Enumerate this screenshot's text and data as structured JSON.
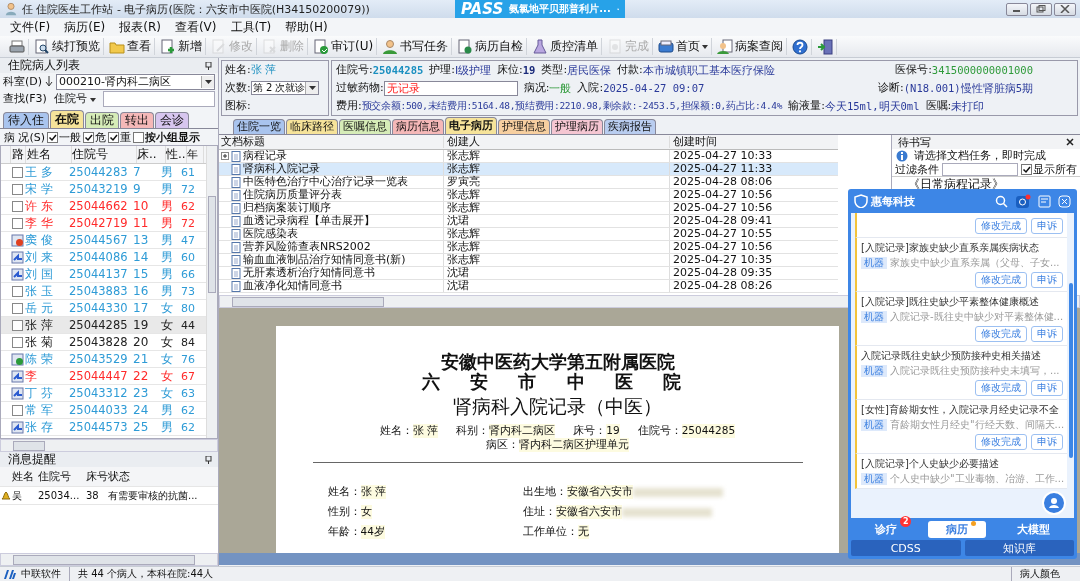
{
  "window": {
    "title": "任 住院医生工作站 - 电子病历(医院：六安市中医院(H34150200079))"
  },
  "pass_bar": {
    "logo": "PASS",
    "drug": "氨氯地平贝那普利片..."
  },
  "menu": [
    "文件(F)",
    "病历(E)",
    "报表(R)",
    "查看(V)",
    "工具(T)",
    "帮助(H)"
  ],
  "toolbar": [
    {
      "kind": "print",
      "disabled": false
    },
    {
      "kind": "preview",
      "label": "续打预览",
      "disabled": false
    },
    {
      "kind": "folder",
      "label": "查看",
      "disabled": false
    },
    {
      "kind": "new",
      "label": "新增",
      "disabled": false
    },
    {
      "kind": "edit",
      "label": "修改",
      "disabled": true
    },
    {
      "kind": "delete",
      "label": "删除",
      "disabled": true
    },
    {
      "kind": "audit",
      "label": "审订(U)",
      "disabled": false
    },
    {
      "kind": "task",
      "label": "书写任务",
      "disabled": false
    },
    {
      "kind": "selfcheck",
      "label": "病历自检",
      "disabled": false
    },
    {
      "kind": "quality",
      "label": "质控清单",
      "disabled": false
    },
    {
      "kind": "done",
      "label": "完成",
      "disabled": true
    },
    {
      "kind": "home",
      "label": "首页",
      "disabled": false
    },
    {
      "kind": "review",
      "label": "病案查阅",
      "disabled": false
    },
    {
      "kind": "help",
      "disabled": false
    },
    {
      "kind": "exit",
      "disabled": false
    }
  ],
  "patient_list": {
    "title": "住院病人列表",
    "dept_label": "科室(D)",
    "dept_value": "000210-肾内科二病区",
    "search_label": "查找(F3)",
    "search_type": "住院号",
    "tabs": [
      {
        "label": "待入住",
        "color": "#a9c4ee",
        "selected": false
      },
      {
        "label": "在院",
        "color": "#f6e39a",
        "selected": true
      },
      {
        "label": "出院",
        "color": "#d6ecb8",
        "selected": false
      },
      {
        "label": "转出",
        "color": "#f5b8b8",
        "selected": false
      },
      {
        "label": "会诊",
        "color": "#d7c6ef",
        "selected": false
      }
    ],
    "filter_label": "病 况(S)",
    "filters": [
      {
        "label": "一般",
        "checked": true
      },
      {
        "label": "危",
        "checked": true
      },
      {
        "label": "重",
        "checked": true
      },
      {
        "label": "按小组显示",
        "checked": false
      }
    ],
    "columns": [
      "路",
      "姓名",
      "住院号",
      "床..",
      "性..",
      "年"
    ],
    "rows": [
      {
        "kind": "checkbox",
        "name": "王 多",
        "no": "25044283",
        "bed": "7",
        "sex": "男",
        "age": "61",
        "color": "#2e9bd6",
        "selected": false
      },
      {
        "kind": "checkbox",
        "name": "宋 学",
        "no": "25043219",
        "bed": "9",
        "sex": "男",
        "age": "72",
        "color": "#2e9bd6",
        "selected": false
      },
      {
        "kind": "checkbox",
        "name": "许 东",
        "no": "25044662",
        "bed": "10",
        "sex": "男",
        "age": "62",
        "color": "#ff2a2a",
        "selected": false
      },
      {
        "kind": "checkbox",
        "name": "李 华",
        "no": "25042719",
        "bed": "11",
        "sex": "男",
        "age": "72",
        "color": "#ff2a2a",
        "selected": false
      },
      {
        "kind": "stop",
        "name": "窦 俊",
        "no": "25044567",
        "bed": "13",
        "sex": "男",
        "age": "47",
        "color": "#2e9bd6",
        "selected": false
      },
      {
        "kind": "path",
        "name": "刘 来",
        "no": "25044086",
        "bed": "14",
        "sex": "男",
        "age": "60",
        "color": "#2e9bd6",
        "selected": false
      },
      {
        "kind": "path",
        "name": "刘 国",
        "no": "25044137",
        "bed": "15",
        "sex": "男",
        "age": "66",
        "color": "#2e9bd6",
        "selected": false
      },
      {
        "kind": "checkbox",
        "name": "张 玉",
        "no": "25043883",
        "bed": "16",
        "sex": "男",
        "age": "73",
        "color": "#2e9bd6",
        "selected": false
      },
      {
        "kind": "checkbox",
        "name": "岳 元",
        "no": "25044330",
        "bed": "17",
        "sex": "女",
        "age": "80",
        "color": "#2e9bd6",
        "selected": false
      },
      {
        "kind": "checkbox",
        "name": "张 萍",
        "no": "25044285",
        "bed": "19",
        "sex": "女",
        "age": "44",
        "color": "#222222",
        "selected": true
      },
      {
        "kind": "checkbox",
        "name": "张 菊",
        "no": "25043828",
        "bed": "20",
        "sex": "女",
        "age": "84",
        "color": "#222222",
        "selected": false
      },
      {
        "kind": "done",
        "name": "陈 荣",
        "no": "25043529",
        "bed": "21",
        "sex": "女",
        "age": "76",
        "color": "#2e9bd6",
        "selected": false
      },
      {
        "kind": "path",
        "name": "李",
        "no": "25044447",
        "bed": "22",
        "sex": "女",
        "age": "67",
        "color": "#ff2a2a",
        "selected": false
      },
      {
        "kind": "path",
        "name": "丁 芬",
        "no": "25043312",
        "bed": "23",
        "sex": "女",
        "age": "63",
        "color": "#2e9bd6",
        "selected": false
      },
      {
        "kind": "checkbox",
        "name": "常 军",
        "no": "25044033",
        "bed": "24",
        "sex": "男",
        "age": "62",
        "color": "#2e9bd6",
        "selected": false
      },
      {
        "kind": "path",
        "name": "张 存",
        "no": "25044573",
        "bed": "25",
        "sex": "男",
        "age": "62",
        "color": "#2e9bd6",
        "selected": false
      }
    ]
  },
  "messages": {
    "title": "消息提醒",
    "columns": [
      "姓名",
      "住院号",
      "床号",
      "状态"
    ],
    "rows": [
      {
        "name": "吴",
        "no": "25034...",
        "bed": "38",
        "status": "有需要审核的抗菌..."
      }
    ]
  },
  "patient_info": {
    "name_label": "姓名:",
    "name": "张 萍",
    "visit_label": "次数:",
    "visit": "第 2 次就诊",
    "icon_label": "图标:",
    "lines": [
      [
        {
          "label": "住院号:",
          "value": "25044285",
          "kind": "id"
        },
        {
          "label": "护理:",
          "value": "Ⅰ级护理",
          "kind": "text"
        },
        {
          "label": "床位:",
          "value": "19",
          "kind": "bold"
        },
        {
          "label": "类型:",
          "value": "居民医保",
          "kind": "text"
        },
        {
          "label": "付款:",
          "value": "本市城镇职工基本医疗保险",
          "kind": "text"
        },
        {
          "label": "医保号:",
          "value": "3415000000001000",
          "kind": "ok"
        }
      ],
      [
        {
          "label": "过敏药物:",
          "value": "无记录",
          "kind": "field"
        },
        {
          "label": "病况:",
          "value": "一般",
          "kind": "ok"
        },
        {
          "label": "入院:",
          "value": "2025-04-27 09:07",
          "kind": "text"
        },
        {
          "label": "诊断:",
          "value": "(N18.001)慢性肾脏病5期",
          "kind": "text"
        }
      ],
      [
        {
          "label": "费用:",
          "value": "预交余额:500,未结费用:5164.48,预结费用:2210.98,剩余款:-2453.5,担保额:0,药占比:4.4%",
          "kind": "text"
        },
        {
          "label": "输液量:",
          "value": "今天15ml,明天0ml",
          "kind": "text"
        },
        {
          "label": "医嘱:",
          "value": "未打印",
          "kind": "text"
        }
      ]
    ]
  },
  "record_tabs": [
    {
      "label": "住院一览",
      "color": "#a9c4ee",
      "selected": false
    },
    {
      "label": "临床路径",
      "color": "#f6e39a",
      "selected": false
    },
    {
      "label": "医嘱信息",
      "color": "#d6ecb8",
      "selected": false
    },
    {
      "label": "病历信息",
      "color": "#f5b8b8",
      "selected": false
    },
    {
      "label": "电子病历",
      "color": "#f6e39a",
      "selected": true
    },
    {
      "label": "护理信息",
      "color": "#f7cfa0",
      "selected": false
    },
    {
      "label": "护理病历",
      "color": "#f5c6d2",
      "selected": false
    },
    {
      "label": "疾病报告",
      "color": "#b9cdf0",
      "selected": false
    }
  ],
  "documents": {
    "columns": [
      "文档标题",
      "创建人",
      "创建时间"
    ],
    "rows": [
      {
        "title": "病程记录",
        "creator": "张志辉",
        "time": "2025-04-27 10:33",
        "expandable": true,
        "selected": false
      },
      {
        "title": "肾病科入院记录",
        "creator": "张志辉",
        "time": "2025-04-27 11:33",
        "expandable": false,
        "selected": true
      },
      {
        "title": "中医特色治疗中心治疗记录一览表",
        "creator": "罗寅亮",
        "time": "2025-04-28 08:06",
        "expandable": false,
        "selected": false
      },
      {
        "title": "住院病历质量评分表",
        "creator": "张志辉",
        "time": "2025-04-27 10:56",
        "expandable": false,
        "selected": false
      },
      {
        "title": "归档病案装订顺序",
        "creator": "张志辉",
        "time": "2025-04-27 10:56",
        "expandable": false,
        "selected": false
      },
      {
        "title": "血透记录病程【单击展开】",
        "creator": "沈珺",
        "time": "2025-04-28 09:41",
        "expandable": false,
        "selected": false
      },
      {
        "title": "医院感染表",
        "creator": "张志辉",
        "time": "2025-04-27 10:55",
        "expandable": false,
        "selected": false
      },
      {
        "title": "营养风险筛查表NRS2002",
        "creator": "张志辉",
        "time": "2025-04-27 10:56",
        "expandable": false,
        "selected": false
      },
      {
        "title": "输血血液制品治疗知情同意书(新)",
        "creator": "张志辉",
        "time": "2025-04-27 10:35",
        "expandable": false,
        "selected": false
      },
      {
        "title": "无肝素透析治疗知情同意书",
        "creator": "沈珺",
        "time": "2025-04-28 09:35",
        "expandable": false,
        "selected": false
      },
      {
        "title": "血液净化知情同意书",
        "creator": "沈珺",
        "time": "2025-04-28 08:26",
        "expandable": false,
        "selected": false
      }
    ]
  },
  "pending": {
    "title": "待书写",
    "hint": "请选择文档任务，即时完成",
    "filter_label": "过滤条件",
    "show_all": {
      "label": "显示所有",
      "checked": true
    },
    "items": [
      "《日常病程记录》"
    ]
  },
  "document": {
    "org_lines": [
      "安徽中医药大学第五附属医院",
      "六 安 市 中 医 院"
    ],
    "title": "肾病科入院记录（中医）",
    "header": [
      {
        "label": "姓名：",
        "value": "张 萍"
      },
      {
        "label": "科别：",
        "value": "肾内科二病区"
      },
      {
        "label": "床号：",
        "value": "19"
      },
      {
        "label": "住院号：",
        "value": "25044285"
      },
      {
        "label": "病区：",
        "value": "肾内科二病区护理单元"
      }
    ],
    "fields": [
      {
        "label": "姓名：",
        "value": "张 萍"
      },
      {
        "label": "出生地：",
        "value": "安徽省六安市"
      },
      {
        "label": "性别：",
        "value": "女"
      },
      {
        "label": "住址：",
        "value": "安徽省六安市"
      },
      {
        "label": "年龄：",
        "value": "44岁"
      },
      {
        "label": "工作单位：",
        "value": "无"
      }
    ]
  },
  "assistant": {
    "brand": "惠每科技",
    "cards": [
      {
        "actions": [
          "修改完成",
          "申诉"
        ]
      },
      {
        "title": "[入院记录]家族史缺少直系亲属疾病状态",
        "tag": "机器",
        "desc": "家族史中缺少直系亲属（父母、子女...",
        "actions": [
          "修改完成",
          "申诉"
        ]
      },
      {
        "title": "[入院记录]既往史缺少平素整体健康概述",
        "tag": "机器",
        "desc": "入院记录-既往史中缺少对平素整体健...",
        "actions": [
          "修改完成",
          "申诉"
        ]
      },
      {
        "title": "入院记录既往史缺少预防接种史相关描述",
        "tag": "机器",
        "desc": "入院记录既往史预防接种史未填写，...",
        "actions": [
          "修改完成",
          "申诉"
        ]
      },
      {
        "title": "[女性]育龄期女性，入院记录月经史记录不全",
        "tag": "机器",
        "desc": "育龄期女性月经史\"行经天数、间隔天...",
        "actions": [
          "修改完成",
          "申诉"
        ]
      },
      {
        "title": "[入院记录]个人史缺少必要描述",
        "tag": "机器",
        "desc": "个人史中缺少\"工业毒物、冶游、工作..."
      }
    ],
    "tabs": [
      {
        "label": "诊疗",
        "badge": "2",
        "dot": false,
        "selected": false
      },
      {
        "label": "病历",
        "dot": true,
        "selected": true
      },
      {
        "label": "大模型",
        "dot": false,
        "selected": false
      }
    ],
    "buttons": [
      "CDSS",
      "知识库"
    ]
  },
  "status_bar": {
    "brand": "中联软件",
    "summary": "共 44 个病人，本科在院:44人",
    "legend": "病人颜色"
  }
}
